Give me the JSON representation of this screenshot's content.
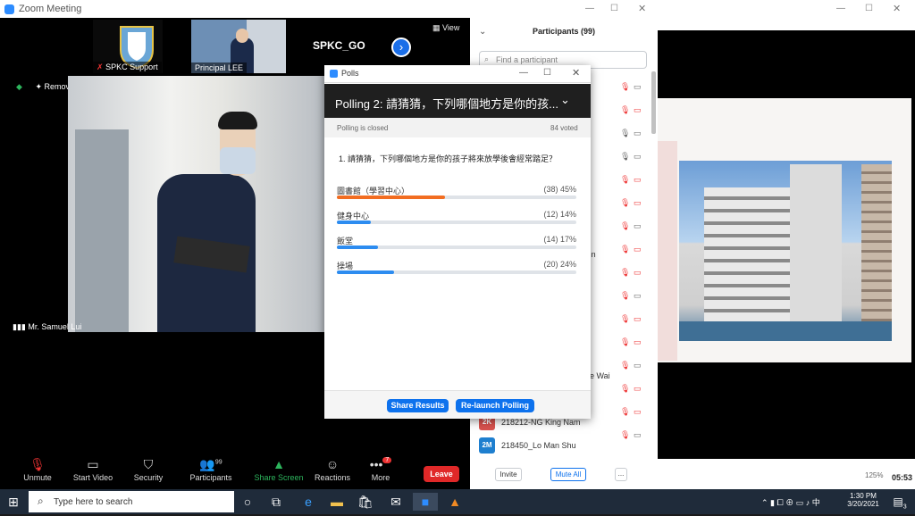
{
  "zoom": {
    "title": "Zoom Meeting",
    "view_label": "View",
    "thumbs": [
      {
        "label": "SPKC Support"
      },
      {
        "label": "Principal LEE"
      },
      {
        "label": "SPKC_GO"
      }
    ],
    "remove_spotlight": "Remove Spotlight",
    "speaker": "Mr. Samuel Lui",
    "toolbar": {
      "unmute": "Unmute",
      "start_video": "Start Video",
      "security": "Security",
      "participants": "Participants",
      "participants_count": "99",
      "share_screen": "Share Screen",
      "reactions": "Reactions",
      "more": "More",
      "more_badge": "7",
      "leave": "Leave"
    }
  },
  "participants_panel": {
    "title": "Participants (99)",
    "search_placeholder": "Find a participant",
    "fragments": [
      "ril",
      "Yin",
      "e Wai"
    ],
    "rows": [
      {
        "initials": "2K",
        "name": "218212-NG King Nam",
        "color": "#d9534f"
      },
      {
        "initials": "2M",
        "name": "218450_Lo Man Shu",
        "color": "#1e7fcf"
      }
    ],
    "invite": "Invite",
    "mute_all": "Mute All",
    "more": "..."
  },
  "right_window": {
    "zoom_pct": "125%",
    "timer": "05:53"
  },
  "polls": {
    "window_title": "Polls",
    "poll_title": "Polling 2: 請猜猜，下列哪個地方是你的孩...",
    "status": "Polling is closed",
    "voted": "84 voted",
    "question": "1. 請猜猜，下列哪個地方是你的孩子將來放學後會經常踏足？",
    "options": [
      {
        "label": "圖書館（學習中心）",
        "value": "(38) 45%",
        "pct": 45,
        "color": "#f26d21"
      },
      {
        "label": "健身中心",
        "value": "(12) 14%",
        "pct": 14,
        "color": "#2d8cf0"
      },
      {
        "label": "飯堂",
        "value": "(14) 17%",
        "pct": 17,
        "color": "#2d8cf0"
      },
      {
        "label": "操場",
        "value": "(20) 24%",
        "pct": 24,
        "color": "#2d8cf0"
      }
    ],
    "share_results": "Share Results",
    "relaunch": "Re-launch Polling"
  },
  "taskbar": {
    "search_placeholder": "Type here to search",
    "time": "1:30 PM",
    "date": "3/20/2021",
    "notif_count": "3"
  }
}
